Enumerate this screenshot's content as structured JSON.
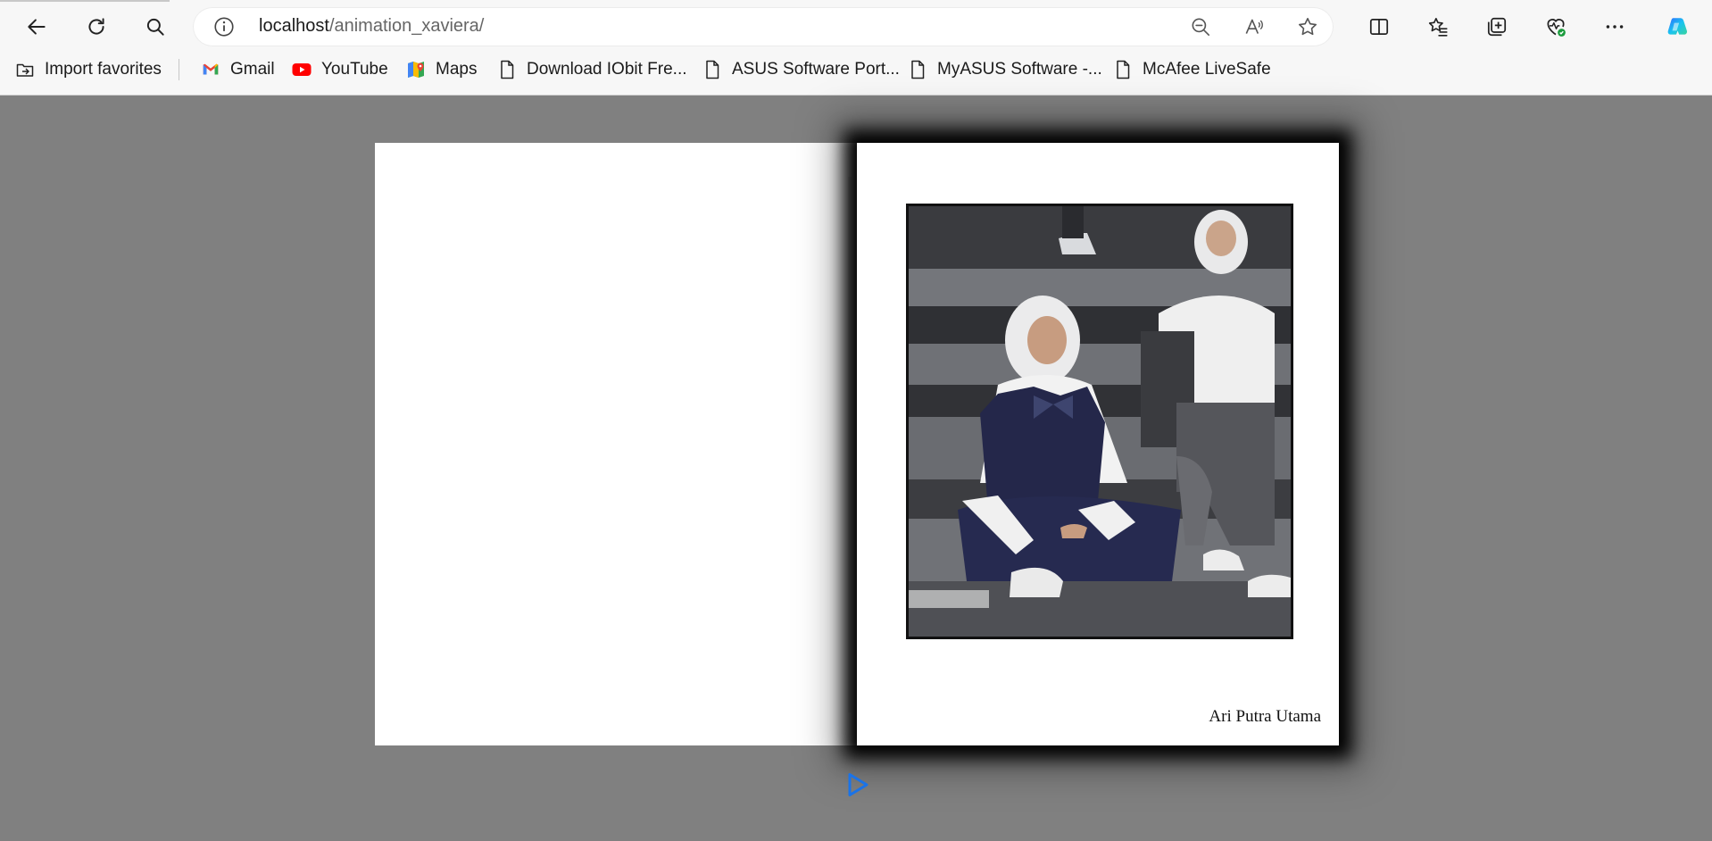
{
  "browser": {
    "address": {
      "host": "localhost",
      "path": "/animation_xaviera/"
    },
    "bookmarks": [
      {
        "label": "Import favorites",
        "icon": "import-favorites-icon"
      },
      {
        "label": "Gmail",
        "icon": "gmail-icon"
      },
      {
        "label": "YouTube",
        "icon": "youtube-icon"
      },
      {
        "label": "Maps",
        "icon": "maps-icon"
      },
      {
        "label": "Download IObit Fre...",
        "icon": "page-icon"
      },
      {
        "label": "ASUS Software Port...",
        "icon": "page-icon"
      },
      {
        "label": "MyASUS Software -...",
        "icon": "page-icon"
      },
      {
        "label": "McAfee LiveSafe",
        "icon": "page-icon"
      }
    ],
    "accent": "#1a73e8"
  },
  "book": {
    "caption": "Ari Putra Utama",
    "photo_subject": "two students in hijab and uniforms sitting on grey steps"
  },
  "controls": {
    "play_icon": "play-icon",
    "play_color": "#1a73e8"
  }
}
